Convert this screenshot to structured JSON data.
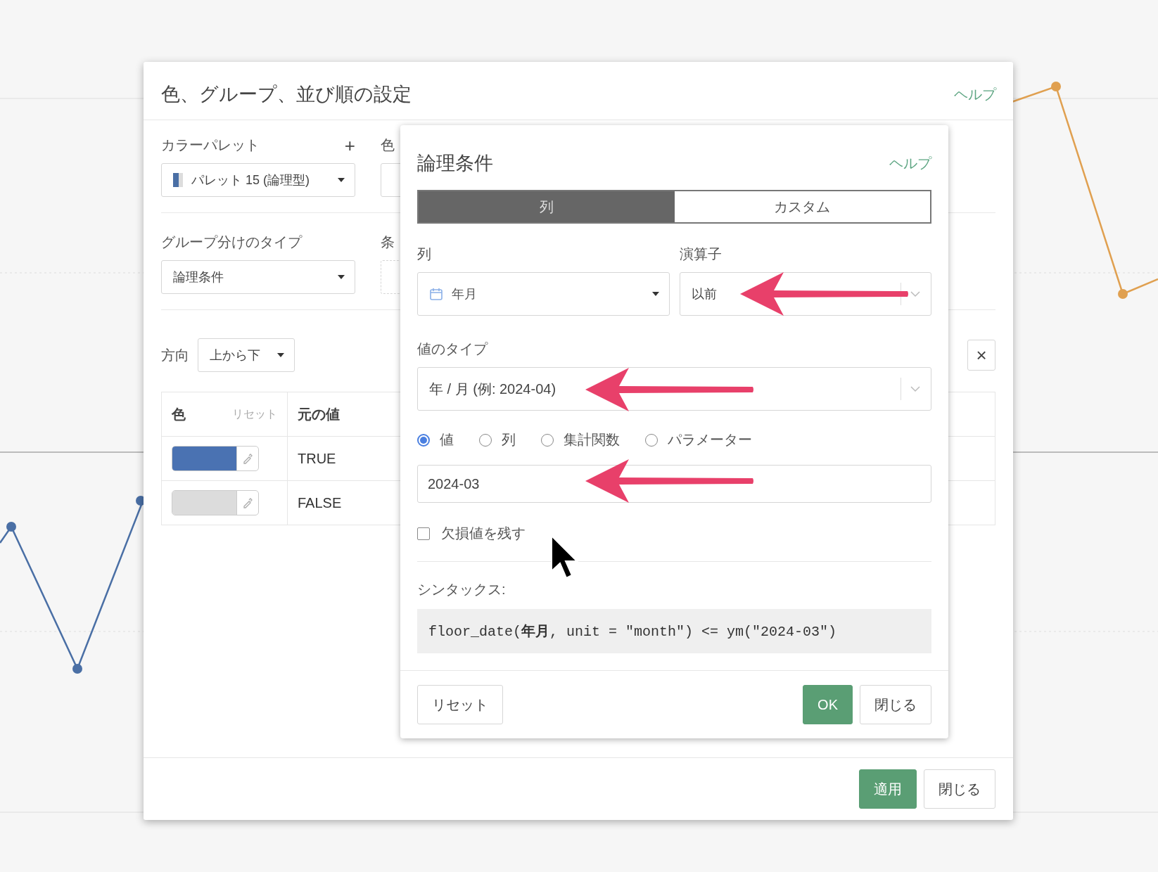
{
  "dialog": {
    "title": "色、グループ、並び順の設定",
    "help_link": "ヘルプ",
    "color_palette": {
      "label": "カラーパレット",
      "add_button": "+",
      "value": "パレット 15 (論理型)"
    },
    "color_label": "色",
    "grouping_type": {
      "label": "グループ分けのタイプ",
      "value": "論理条件"
    },
    "condition_label": "条",
    "direction": {
      "label": "方向",
      "value": "上から下"
    },
    "close_button": "×",
    "table": {
      "columns": [
        {
          "label": "色",
          "action": "リセット"
        },
        {
          "label": "元の値"
        }
      ],
      "rows": [
        {
          "color": "#4a72b2",
          "value": "TRUE"
        },
        {
          "color": "#dcdcdc",
          "value": "FALSE"
        }
      ]
    },
    "buttons": [
      {
        "label": "適用",
        "kind": "primary"
      },
      {
        "label": "閉じる",
        "kind": "default"
      }
    ]
  },
  "popover": {
    "title": "論理条件",
    "help_link": "ヘルプ",
    "tabs": [
      {
        "label": "列",
        "selected": true
      },
      {
        "label": "カスタム",
        "selected": false
      }
    ],
    "column": {
      "label": "列",
      "value": "年月"
    },
    "operator": {
      "label": "演算子",
      "value": "以前"
    },
    "value_type": {
      "label": "値のタイプ",
      "value": "年 / 月 (例: 2024-04)"
    },
    "value_sources": [
      {
        "label": "値",
        "selected": true
      },
      {
        "label": "列",
        "selected": false
      },
      {
        "label": "集計関数",
        "selected": false
      },
      {
        "label": "パラメーター",
        "selected": false
      }
    ],
    "value": "2024-03",
    "keep_missing": {
      "label": "欠損値を残す",
      "checked": false
    },
    "syntax": {
      "label": "シンタックス:",
      "code": "floor_date(**年月**, unit = \"month\") <= ym(\"2024-03\")"
    },
    "buttons": [
      {
        "label": "リセット",
        "kind": "default"
      },
      {
        "label": "OK",
        "kind": "primary"
      },
      {
        "label": "閉じる",
        "kind": "default"
      }
    ]
  }
}
